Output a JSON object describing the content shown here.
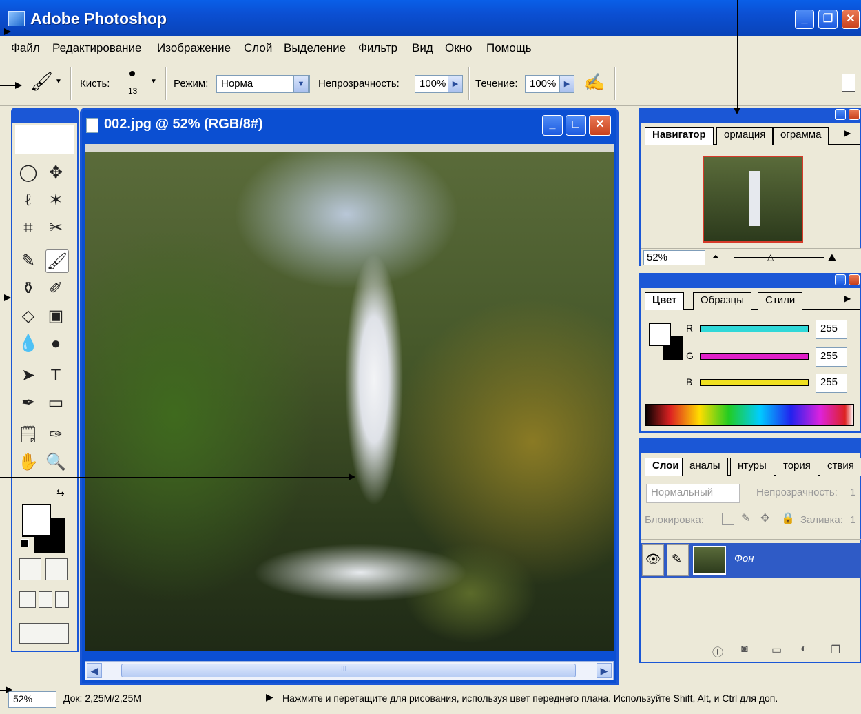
{
  "window": {
    "title": "Adobe Photoshop",
    "controls": {
      "minimize": "_",
      "maximize": "❐",
      "close": "✕"
    }
  },
  "menu": [
    "Файл",
    "Редактирование",
    "Изображение",
    "Слой",
    "Выделение",
    "Фильтр",
    "Вид",
    "Окно",
    "Помощь"
  ],
  "options": {
    "brush_label": "Кисть:",
    "brush_size": "13",
    "mode_label": "Режим:",
    "mode_value": "Норма",
    "opacity_label": "Непрозрачность:",
    "opacity_value": "100%",
    "flow_label": "Течение:",
    "flow_value": "100%"
  },
  "document": {
    "title": "002.jpg @ 52% (RGB/8#)",
    "scroll_mark": "III"
  },
  "navigator": {
    "tabs": [
      "Навигатор",
      "ормация",
      "ограмма"
    ],
    "zoom": "52%"
  },
  "color": {
    "tabs": [
      "Цвет",
      "Образцы",
      "Стили"
    ],
    "channels": [
      {
        "label": "R",
        "value": "255",
        "color": "#30d8d8"
      },
      {
        "label": "G",
        "value": "255",
        "color": "#e020c8"
      },
      {
        "label": "B",
        "value": "255",
        "color": "#f0e020"
      }
    ]
  },
  "layers": {
    "tabs": [
      "Слои",
      "аналы",
      "нтуры",
      "тория",
      "ствия"
    ],
    "blend_mode": "Нормальный",
    "opacity_label": "Непрозрачность:",
    "opacity_value": "1",
    "lock_label": "Блокировка:",
    "fill_label": "Заливка:",
    "fill_value": "1",
    "layer_name": "Фон"
  },
  "status": {
    "zoom": "52%",
    "doc": "Док: 2,25M/2,25M",
    "hint": "Нажмите и перетащите для рисования, используя цвет переднего плана. Используйте Shift, Alt, и Ctrl для доп."
  },
  "colors": {
    "title_blue": "#0b4fd2",
    "panel_bg": "#ece9d8",
    "close_red": "#c8401c",
    "slide_orange": "#d8541c"
  }
}
